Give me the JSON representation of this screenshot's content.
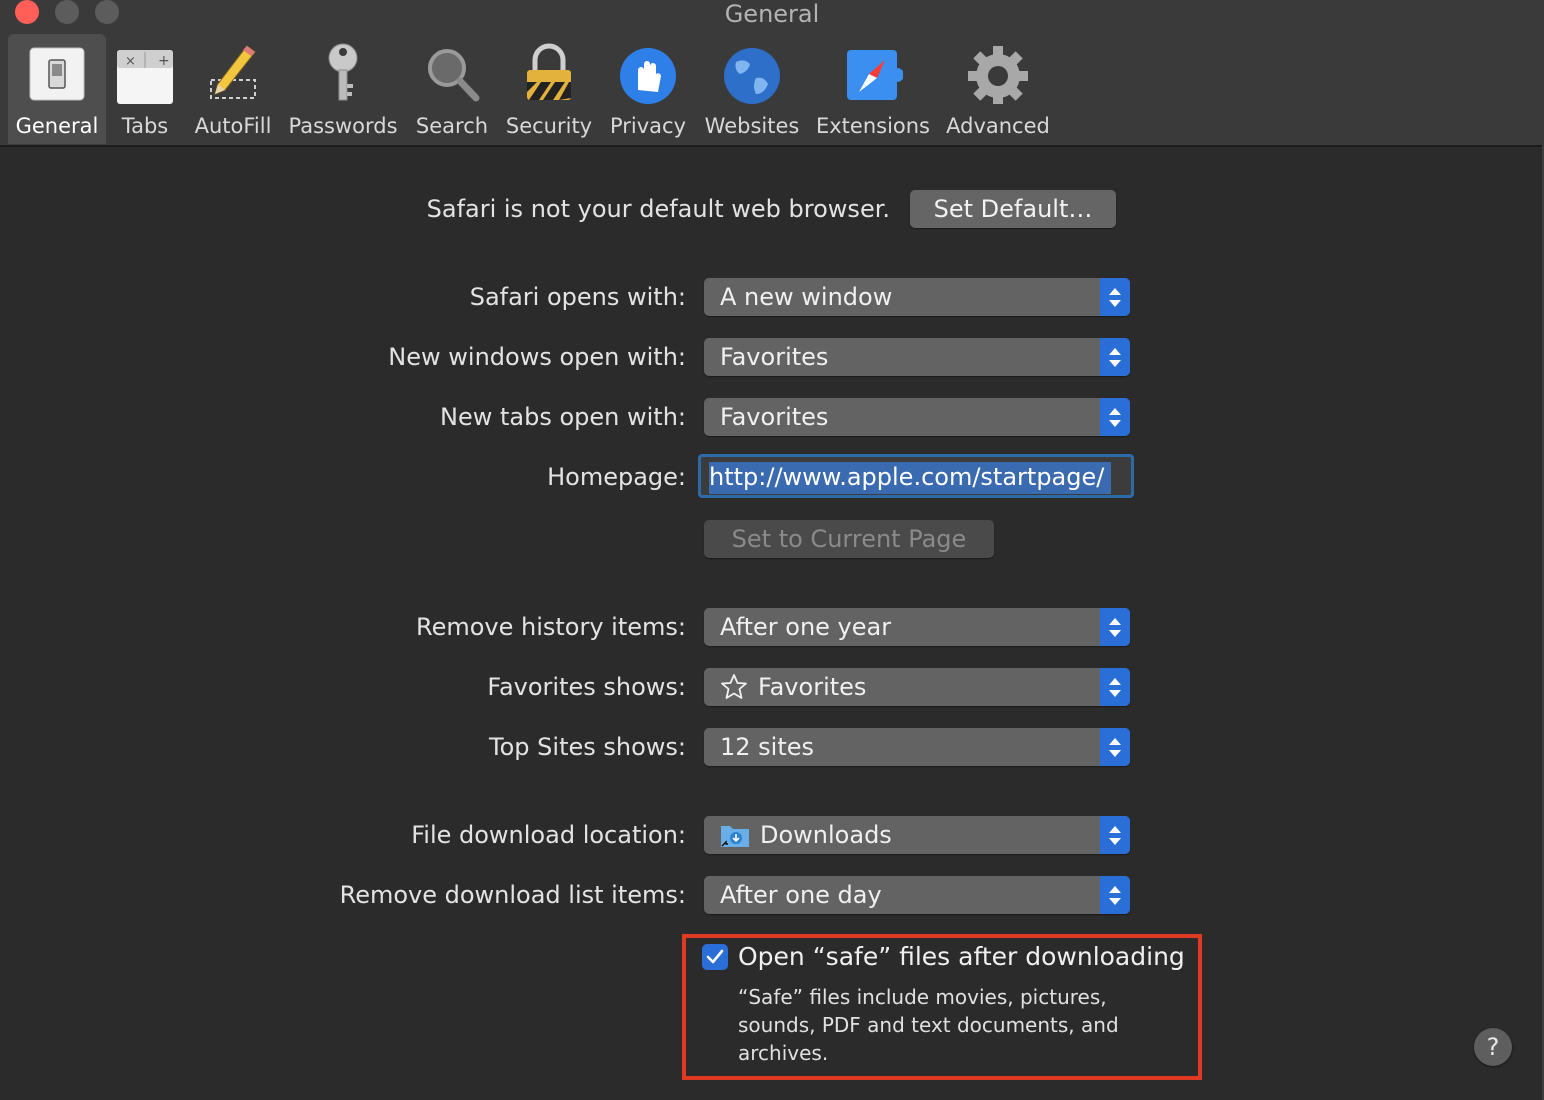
{
  "window": {
    "title": "General",
    "traffic_lights": {
      "close_color": "#ff5f57"
    }
  },
  "toolbar": {
    "tabs": [
      {
        "label": "General",
        "icon": "switch-icon",
        "active": true
      },
      {
        "label": "Tabs",
        "icon": "tabs-icon"
      },
      {
        "label": "AutoFill",
        "icon": "pencil-icon"
      },
      {
        "label": "Passwords",
        "icon": "key-icon"
      },
      {
        "label": "Search",
        "icon": "magnifier-icon"
      },
      {
        "label": "Security",
        "icon": "padlock-icon"
      },
      {
        "label": "Privacy",
        "icon": "hand-icon"
      },
      {
        "label": "Websites",
        "icon": "globe-icon"
      },
      {
        "label": "Extensions",
        "icon": "puzzle-compass-icon"
      },
      {
        "label": "Advanced",
        "icon": "gear-icon"
      }
    ]
  },
  "default_browser": {
    "message": "Safari is not your default web browser.",
    "button": "Set Default…"
  },
  "settings": {
    "safari_opens_with": {
      "label": "Safari opens with:",
      "value": "A new window"
    },
    "new_windows_open_with": {
      "label": "New windows open with:",
      "value": "Favorites"
    },
    "new_tabs_open_with": {
      "label": "New tabs open with:",
      "value": "Favorites"
    },
    "homepage": {
      "label": "Homepage:",
      "value": "http://www.apple.com/startpage/"
    },
    "set_current_page": "Set to Current Page",
    "remove_history_items": {
      "label": "Remove history items:",
      "value": "After one year"
    },
    "favorites_shows": {
      "label": "Favorites shows:",
      "value": "Favorites",
      "icon": "star-icon"
    },
    "top_sites_shows": {
      "label": "Top Sites shows:",
      "value": "12 sites"
    },
    "file_download_location": {
      "label": "File download location:",
      "value": "Downloads",
      "icon": "downloads-folder-icon"
    },
    "remove_download_list_items": {
      "label": "Remove download list items:",
      "value": "After one day"
    }
  },
  "safe_files": {
    "label": "Open “safe” files after downloading",
    "checked": true,
    "description": "“Safe” files include movies, pictures, sounds, PDF and text documents, and archives.",
    "highlight_color": "#e03a22"
  },
  "help": {
    "label": "?"
  },
  "colors": {
    "accent": "#2a6fd8",
    "background": "#2b2b2b",
    "toolbar": "#3a3a3a"
  }
}
